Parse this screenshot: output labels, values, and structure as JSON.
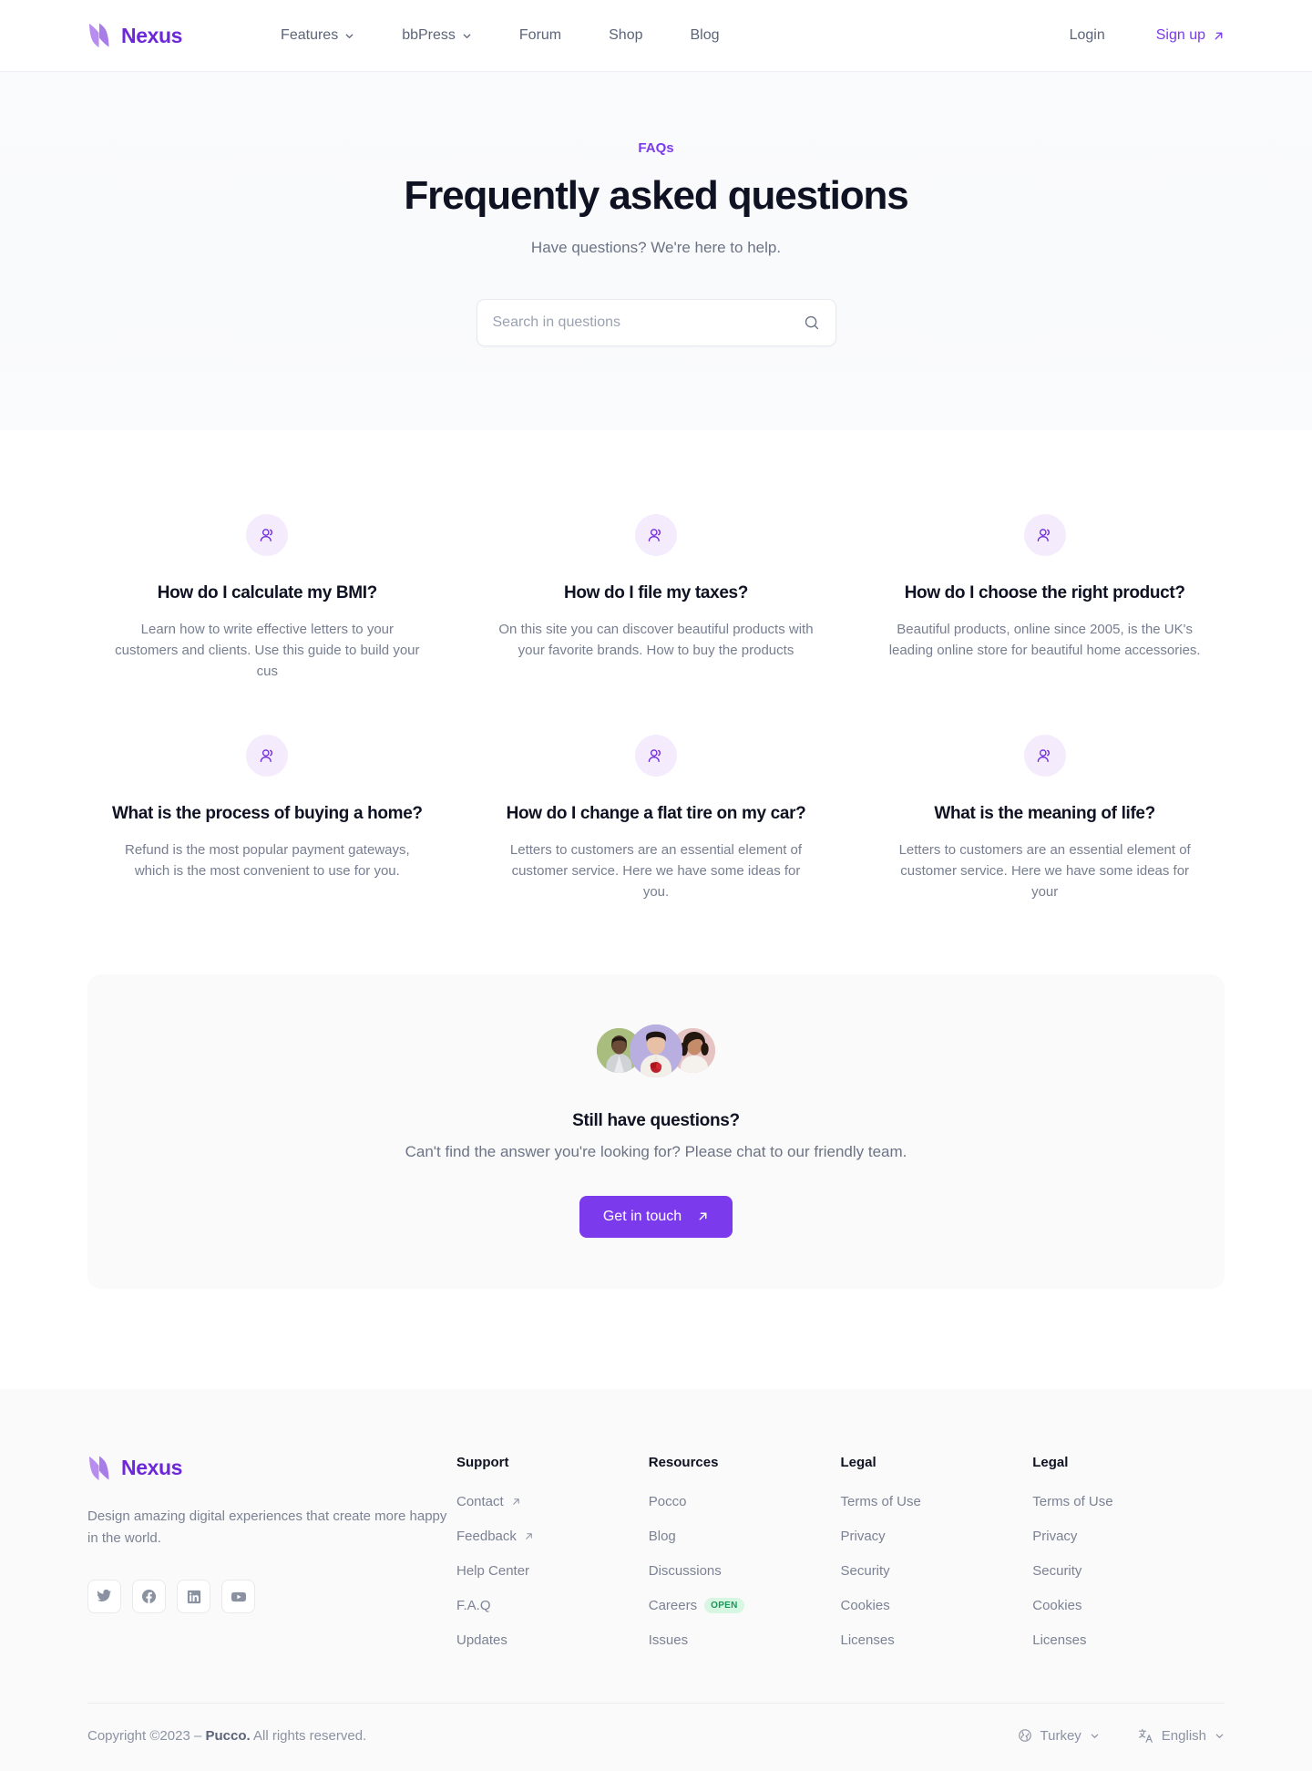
{
  "brand": {
    "name": "Nexus",
    "logo_icon": "nexus-leaf-logo",
    "color": "#6d28d9"
  },
  "nav": {
    "items": [
      {
        "label": "Features",
        "has_dropdown": true,
        "icon": "chevron-down-icon"
      },
      {
        "label": "bbPress",
        "has_dropdown": true,
        "icon": "chevron-down-icon"
      },
      {
        "label": "Forum",
        "has_dropdown": false
      },
      {
        "label": "Shop",
        "has_dropdown": false
      },
      {
        "label": "Blog",
        "has_dropdown": false
      }
    ],
    "login_label": "Login",
    "signup_label": "Sign up",
    "signup_icon": "arrow-up-right-icon"
  },
  "hero": {
    "eyebrow": "FAQs",
    "title": "Frequently asked questions",
    "subtitle": "Have questions? We're here to help.",
    "search_placeholder": "Search in questions",
    "search_value": "",
    "search_icon": "search-icon",
    "accent_color": "#7c3aed"
  },
  "faqs": [
    {
      "icon": "users-icon",
      "question": "How do I calculate my BMI?",
      "answer": "Learn how to write effective letters to your customers and clients. Use this guide to build your cus"
    },
    {
      "icon": "users-icon",
      "question": "How do I file my taxes?",
      "answer": "On this site you can discover beautiful products with your favorite brands. How to buy the products"
    },
    {
      "icon": "users-icon",
      "question": "How do I choose the right product?",
      "answer": "Beautiful products, online since 2005, is the UK's leading online store for beautiful home accessories."
    },
    {
      "icon": "users-icon",
      "question": "What is the process of buying a home?",
      "answer": "Refund is the most popular payment gateways, which is the most convenient to use for you."
    },
    {
      "icon": "users-icon",
      "question": "How do I change a flat tire on my car?",
      "answer": "Letters to customers are an essential element of customer service. Here we have some ideas for you."
    },
    {
      "icon": "users-icon",
      "question": "What is the meaning of life?",
      "answer": "Letters to customers are an essential element of customer service. Here we have some ideas for your"
    }
  ],
  "cta": {
    "title": "Still have questions?",
    "subtitle": "Can't find the answer you're looking for? Please chat to our friendly team.",
    "button_label": "Get in touch",
    "button_icon": "arrow-up-right-icon",
    "button_color": "#7c3aed",
    "avatars": [
      {
        "name": "avatar-1",
        "bg": "#a8bd7e"
      },
      {
        "name": "avatar-2",
        "bg": "#b9aee0"
      },
      {
        "name": "avatar-3",
        "bg": "#e6c4c4"
      }
    ]
  },
  "footer": {
    "brand_name": "Nexus",
    "tagline": "Design amazing digital experiences that create more happy in the world.",
    "socials": [
      {
        "name": "twitter-icon",
        "label": "Twitter"
      },
      {
        "name": "facebook-icon",
        "label": "Facebook"
      },
      {
        "name": "linkedin-icon",
        "label": "LinkedIn"
      },
      {
        "name": "youtube-icon",
        "label": "YouTube"
      }
    ],
    "columns": [
      {
        "title": "Support",
        "links": [
          {
            "label": "Contact",
            "external": true
          },
          {
            "label": "Feedback",
            "external": true
          },
          {
            "label": "Help Center",
            "external": false
          },
          {
            "label": "F.A.Q",
            "external": false
          },
          {
            "label": "Updates",
            "external": false
          }
        ]
      },
      {
        "title": "Resources",
        "links": [
          {
            "label": "Pocco",
            "external": false
          },
          {
            "label": "Blog",
            "external": false
          },
          {
            "label": "Discussions",
            "external": false
          },
          {
            "label": "Careers",
            "external": false,
            "badge": "OPEN"
          },
          {
            "label": "Issues",
            "external": false
          }
        ]
      },
      {
        "title": "Legal",
        "links": [
          {
            "label": "Terms of Use",
            "external": false
          },
          {
            "label": "Privacy",
            "external": false
          },
          {
            "label": "Security",
            "external": false
          },
          {
            "label": "Cookies",
            "external": false
          },
          {
            "label": "Licenses",
            "external": false
          }
        ]
      },
      {
        "title": "Legal",
        "links": [
          {
            "label": "Terms of Use",
            "external": false
          },
          {
            "label": "Privacy",
            "external": false
          },
          {
            "label": "Security",
            "external": false
          },
          {
            "label": "Cookies",
            "external": false
          },
          {
            "label": "Licenses",
            "external": false
          }
        ]
      }
    ],
    "copyright_prefix": "Copyright ©2023 – ",
    "copyright_brand": "Pucco.",
    "copyright_suffix": " All rights reserved.",
    "country": {
      "label": "Turkey",
      "icon": "globe-icon"
    },
    "language": {
      "label": "English",
      "icon": "translate-icon"
    }
  }
}
